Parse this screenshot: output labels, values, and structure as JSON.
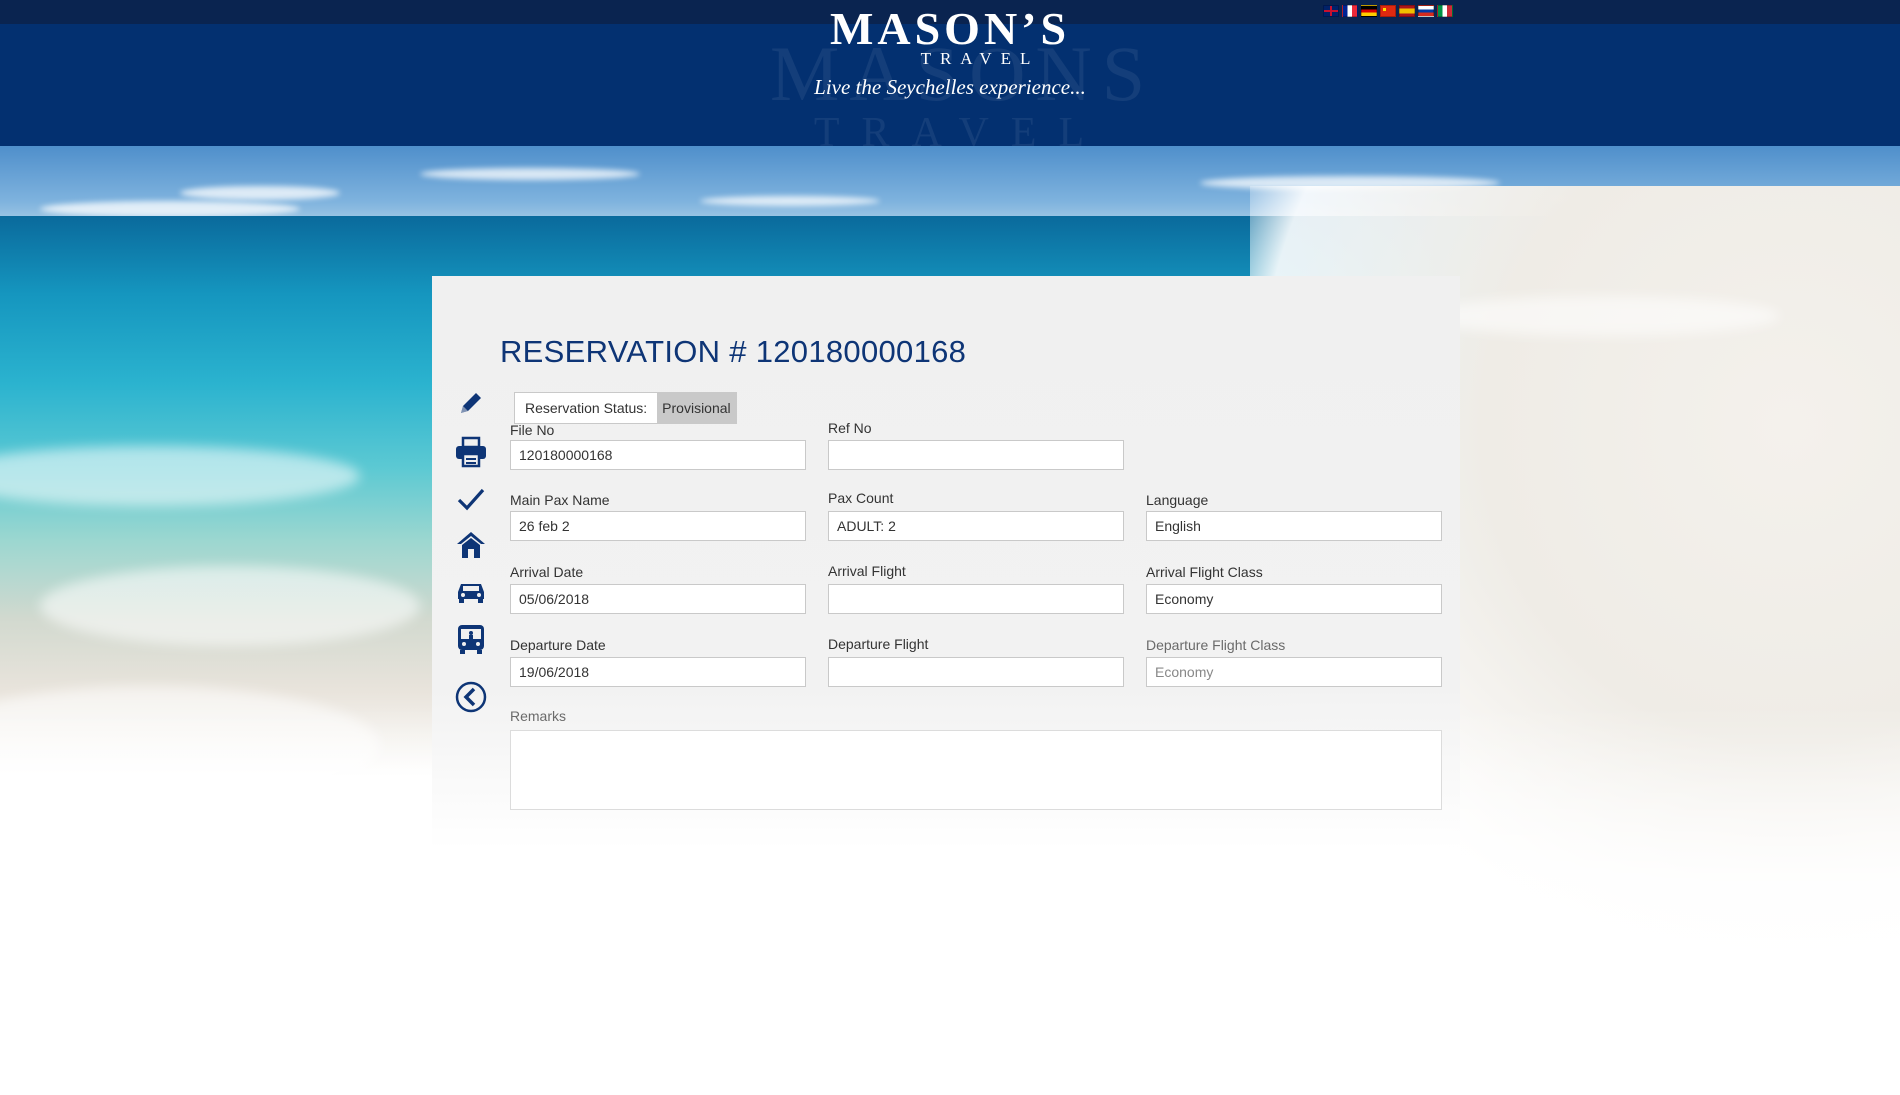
{
  "brand": {
    "name": "MASON’S",
    "sub": "TRAVEL",
    "tagline": "Live the Seychelles experience..."
  },
  "languages": [
    {
      "code": "en",
      "icon": "uk-flag-icon"
    },
    {
      "code": "fr",
      "icon": "france-flag-icon"
    },
    {
      "code": "de",
      "icon": "germany-flag-icon"
    },
    {
      "code": "zh",
      "icon": "china-flag-icon"
    },
    {
      "code": "es",
      "icon": "spain-flag-icon"
    },
    {
      "code": "ru",
      "icon": "russia-flag-icon"
    },
    {
      "code": "it",
      "icon": "italy-flag-icon"
    }
  ],
  "toolbar": [
    {
      "name": "edit",
      "icon": "pencil-icon"
    },
    {
      "name": "print",
      "icon": "printer-icon"
    },
    {
      "name": "confirm",
      "icon": "checkmark-icon"
    },
    {
      "name": "hotel",
      "icon": "home-icon"
    },
    {
      "name": "car",
      "icon": "car-icon"
    },
    {
      "name": "transfer",
      "icon": "bus-icon"
    },
    {
      "name": "back",
      "icon": "back-arrow-icon"
    }
  ],
  "reservation": {
    "title": "RESERVATION # 120180000168",
    "status_label": "Reservation Status:",
    "status_value": "Provisional",
    "fields": {
      "file_no": {
        "label": "File No",
        "value": "120180000168"
      },
      "ref_no": {
        "label": "Ref No",
        "value": ""
      },
      "main_pax_name": {
        "label": "Main Pax Name",
        "value": "26 feb 2"
      },
      "pax_count": {
        "label": "Pax Count",
        "value": "ADULT: 2"
      },
      "language": {
        "label": "Language",
        "value": "English"
      },
      "arrival_date": {
        "label": "Arrival Date",
        "value": "05/06/2018"
      },
      "arrival_flight": {
        "label": "Arrival Flight",
        "value": ""
      },
      "arrival_flight_class": {
        "label": "Arrival Flight Class",
        "value": "Economy"
      },
      "departure_date": {
        "label": "Departure Date",
        "value": "19/06/2018"
      },
      "departure_flight": {
        "label": "Departure Flight",
        "value": ""
      },
      "departure_flight_class": {
        "label": "Departure Flight Class",
        "value": "Economy"
      },
      "remarks": {
        "label": "Remarks",
        "value": ""
      }
    }
  },
  "colors": {
    "header": "#033070",
    "topbar": "#0a2450",
    "title": "#0e3576",
    "icon": "#0e3576",
    "status_highlight": "#c9c9c9"
  }
}
